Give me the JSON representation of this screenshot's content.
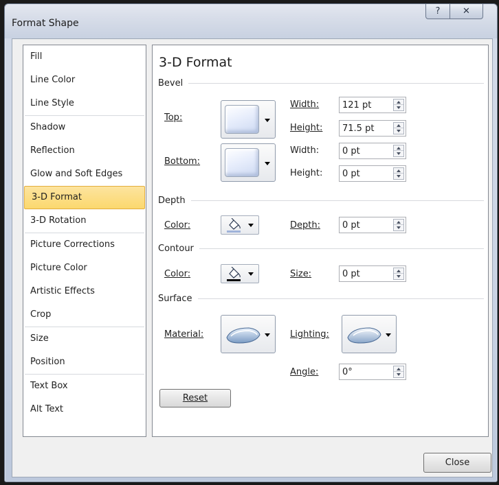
{
  "window": {
    "title": "Format Shape",
    "help_label": "?",
    "close_label": "✕"
  },
  "nav": {
    "items": [
      {
        "label": "Fill"
      },
      {
        "label": "Line Color"
      },
      {
        "label": "Line Style"
      },
      {
        "label": "Shadow"
      },
      {
        "label": "Reflection"
      },
      {
        "label": "Glow and Soft Edges"
      },
      {
        "label": "3-D Format",
        "selected": true
      },
      {
        "label": "3-D Rotation"
      },
      {
        "label": "Picture Corrections"
      },
      {
        "label": "Picture Color"
      },
      {
        "label": "Artistic Effects"
      },
      {
        "label": "Crop"
      },
      {
        "label": "Size"
      },
      {
        "label": "Position"
      },
      {
        "label": "Text Box"
      },
      {
        "label": "Alt Text"
      }
    ]
  },
  "panel": {
    "title": "3-D Format",
    "bevel": {
      "section_label": "Bevel",
      "top_label": "Top:",
      "bottom_label": "Bottom:",
      "top_width_label": "Width:",
      "top_width_value": "121 pt",
      "top_height_label": "Height:",
      "top_height_value": "71.5 pt",
      "bottom_width_label": "Width:",
      "bottom_width_value": "0 pt",
      "bottom_height_label": "Height:",
      "bottom_height_value": "0 pt"
    },
    "depth": {
      "section_label": "Depth",
      "color_label": "Color:",
      "depth_label": "Depth:",
      "depth_value": "0 pt"
    },
    "contour": {
      "section_label": "Contour",
      "color_label": "Color:",
      "size_label": "Size:",
      "size_value": "0 pt"
    },
    "surface": {
      "section_label": "Surface",
      "material_label": "Material:",
      "lighting_label": "Lighting:",
      "angle_label": "Angle:",
      "angle_value": "0°"
    },
    "reset_label": "Reset"
  },
  "footer": {
    "close_label": "Close"
  },
  "colors": {
    "selection": "#fbd86e",
    "selection_border": "#e3ad3b",
    "depth_swatch": "#9fb3d9",
    "contour_swatch": "#000000"
  }
}
